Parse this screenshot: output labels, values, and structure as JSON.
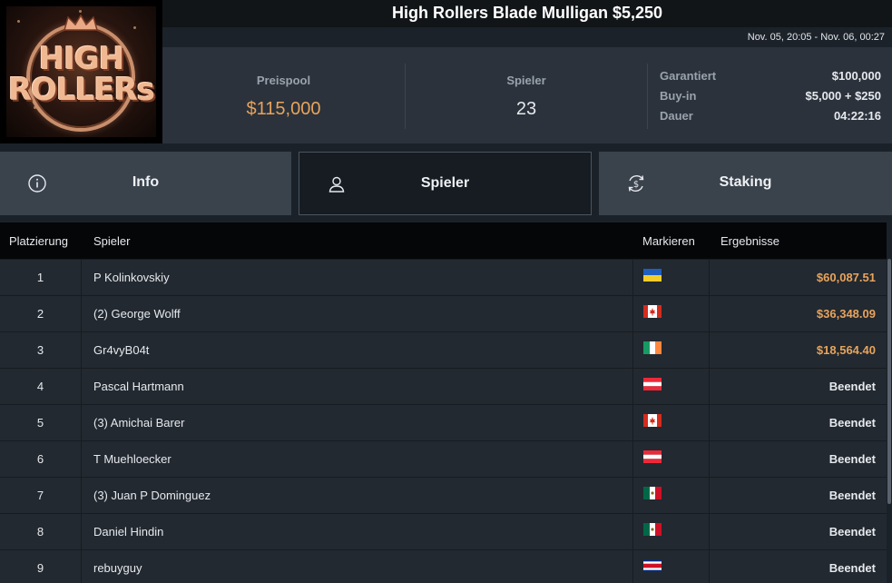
{
  "tournament": {
    "title": "High Rollers Blade Mulligan $5,250",
    "dates": "Nov. 05, 20:05 - Nov. 06, 00:27",
    "logo_text_line1": "HIGH",
    "logo_text_line2": "ROLLERs"
  },
  "stats": {
    "prizepool_label": "Preispool",
    "prizepool_value": "$115,000",
    "players_label": "Spieler",
    "players_value": "23",
    "details": [
      {
        "key": "Garantiert",
        "value": "$100,000"
      },
      {
        "key": "Buy-in",
        "value": "$5,000 + $250"
      },
      {
        "key": "Dauer",
        "value": "04:22:16"
      }
    ]
  },
  "tabs": [
    {
      "label": "Info",
      "icon": "info-icon",
      "active": false
    },
    {
      "label": "Spieler",
      "icon": "user-icon",
      "active": true
    },
    {
      "label": "Staking",
      "icon": "dollar-cycle-icon",
      "active": false
    }
  ],
  "table": {
    "headers": [
      "Platzierung",
      "Spieler",
      "Markieren",
      "Ergebnisse"
    ],
    "rows": [
      {
        "rank": "1",
        "name": "P Kolinkovskiy",
        "flag": "ukraine-flag-icon",
        "result": "$60,087.51",
        "paid": true
      },
      {
        "rank": "2",
        "name": "(2) George Wolff",
        "flag": "canada-flag-icon",
        "result": "$36,348.09",
        "paid": true
      },
      {
        "rank": "3",
        "name": "Gr4vyB04t",
        "flag": "ireland-flag-icon",
        "result": "$18,564.40",
        "paid": true
      },
      {
        "rank": "4",
        "name": "Pascal Hartmann",
        "flag": "austria-flag-icon",
        "result": "Beendet",
        "paid": false
      },
      {
        "rank": "5",
        "name": "(3) Amichai Barer",
        "flag": "canada-flag-icon",
        "result": "Beendet",
        "paid": false
      },
      {
        "rank": "6",
        "name": "T Muehloecker",
        "flag": "austria-flag-icon",
        "result": "Beendet",
        "paid": false
      },
      {
        "rank": "7",
        "name": "(3) Juan P Dominguez",
        "flag": "mexico-flag-icon",
        "result": "Beendet",
        "paid": false
      },
      {
        "rank": "8",
        "name": "Daniel Hindin",
        "flag": "mexico-flag-icon",
        "result": "Beendet",
        "paid": false
      },
      {
        "rank": "9",
        "name": "rebuyguy",
        "flag": "costa-rica-flag-icon",
        "result": "Beendet",
        "paid": false
      }
    ]
  },
  "colors": {
    "accent": "#e8a35c",
    "background": "#1b2128",
    "panel": "#2b323b",
    "tab": "#3a424c",
    "tab_active": "#161c22"
  }
}
